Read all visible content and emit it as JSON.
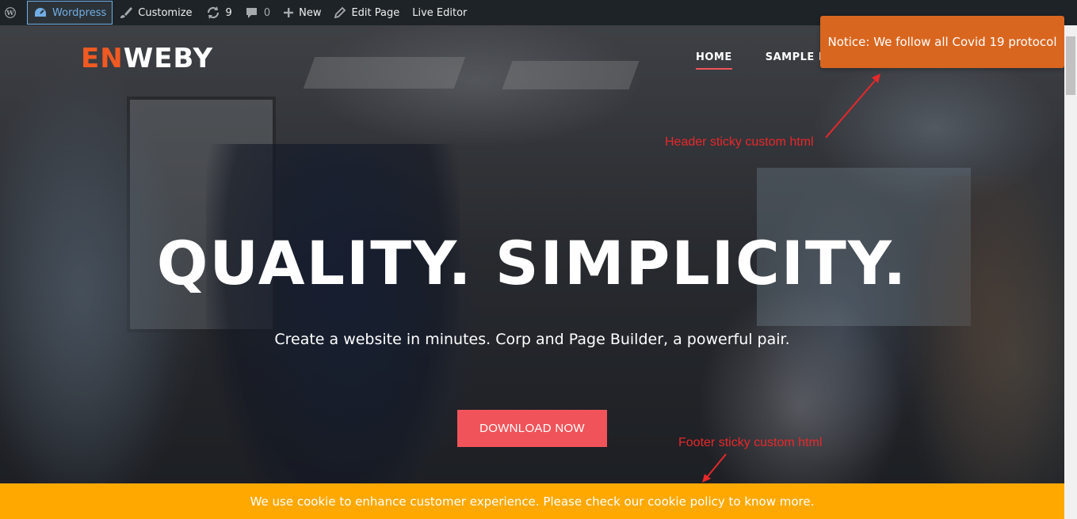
{
  "admin_bar": {
    "site_name": "Wordpress",
    "customize": "Customize",
    "updates_count": "9",
    "comments_count": "0",
    "new": "New",
    "edit_page": "Edit Page",
    "live_editor": "Live Editor"
  },
  "site": {
    "logo_accent": "EN",
    "logo_rest": "WEBY",
    "nav": [
      "HOME",
      "SAMPLE P"
    ]
  },
  "hero": {
    "headline": "QUALITY. SIMPLICITY.",
    "subheadline": "Create a website in minutes. Corp and Page Builder, a powerful pair.",
    "cta": "DOWNLOAD NOW"
  },
  "notice": {
    "text": "Notice: We follow all Covid 19 protocol"
  },
  "annotations": {
    "header": "Header sticky custom html",
    "footer": "Footer sticky custom html"
  },
  "cookie": {
    "text": "We use cookie to enhance customer experience. Please check our cookie policy to know more."
  },
  "colors": {
    "admin_bar": "#1d2327",
    "accent_red": "#f0545a",
    "logo_orange": "#f05a22",
    "notice_orange": "#d9661f",
    "cookie_yellow": "#ffa800",
    "annotation_red": "#e8282a"
  }
}
